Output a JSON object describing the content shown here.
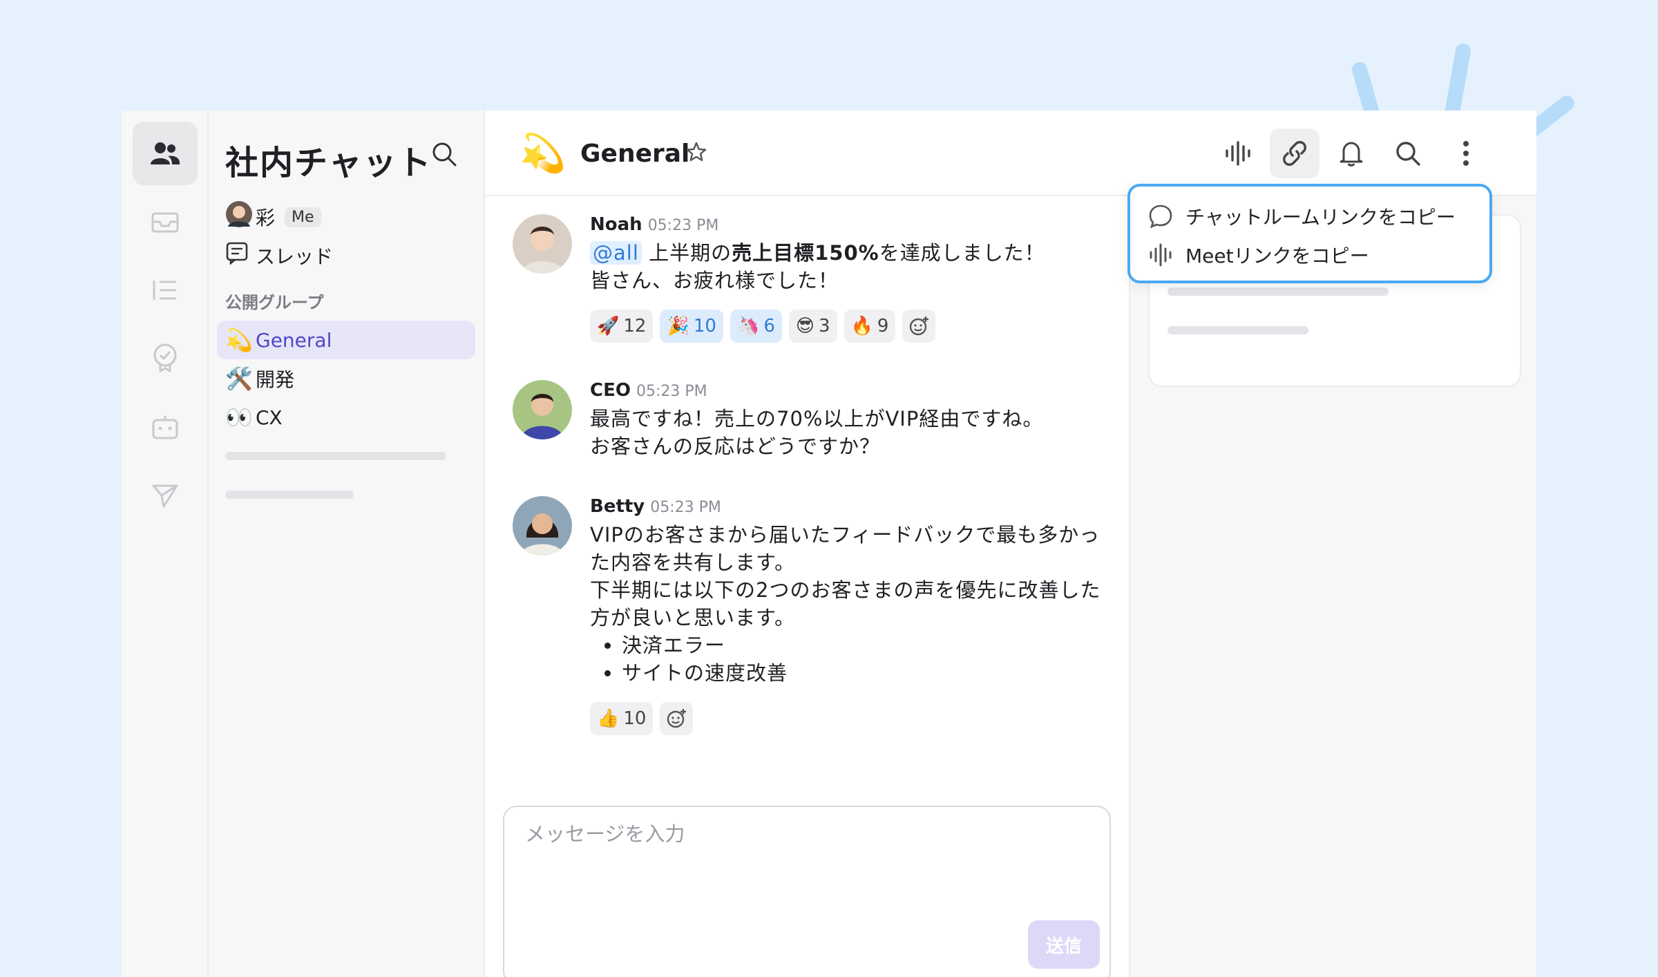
{
  "app": {
    "sidebar_title": "社内チャット",
    "me_name": "彩",
    "me_badge": "Me",
    "threads_label": "スレッド",
    "section_label": "公開グループ",
    "channels": [
      {
        "emoji": "💫",
        "name": "General",
        "active": true
      },
      {
        "emoji": "🛠️",
        "name": "開発",
        "active": false
      },
      {
        "emoji": "👀",
        "name": "CX",
        "active": false
      }
    ]
  },
  "channel": {
    "emoji": "💫",
    "name": "General"
  },
  "dropdown": {
    "items": [
      "チャットルームリンクをコピー",
      "Meetリンクをコピー"
    ]
  },
  "messages": [
    {
      "author": "Noah",
      "time": "05:23 PM",
      "mention": "@all",
      "text_pre": "上半期の",
      "text_bold": "売上目標150%",
      "text_post": "を達成しました！",
      "line2": "皆さん、お疲れ様でした！",
      "reactions": [
        {
          "emoji": "🚀",
          "count": "12"
        },
        {
          "emoji": "🎉",
          "count": "10"
        },
        {
          "emoji": "🦄",
          "count": "6"
        },
        {
          "emoji": "😎",
          "count": "3"
        },
        {
          "emoji": "🔥",
          "count": "9"
        }
      ]
    },
    {
      "author": "CEO",
      "time": "05:23 PM",
      "line1": "最高ですね！売上の70%以上がVIP経由ですね。",
      "line2": "お客さんの反応はどうですか？"
    },
    {
      "author": "Betty",
      "time": "05:23 PM",
      "line1": "VIPのお客さまから届いたフィードバックで最も多かった内容を共有します。",
      "line2": "下半期には以下の2つのお客さまの声を優先に改善した方が良いと思います。",
      "bullets": [
        "決済エラー",
        "サイトの速度改善"
      ],
      "reactions": [
        {
          "emoji": "👍",
          "count": "10"
        }
      ]
    }
  ],
  "composer": {
    "placeholder": "メッセージを入力",
    "send_label": "送信"
  },
  "colors": {
    "accent": "#4e46c9",
    "highlight": "#4aa9f2",
    "background": "#e5f2fd"
  }
}
